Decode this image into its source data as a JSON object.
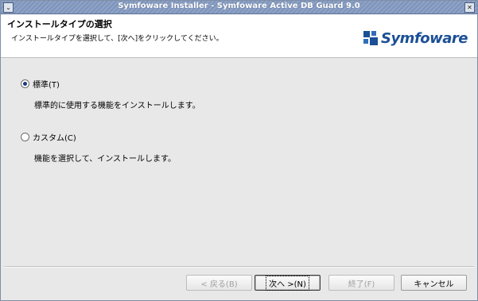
{
  "window": {
    "title": "Symfoware Installer - Symfoware Active DB Guard 9.0",
    "menu_glyph": "⌄",
    "close_glyph": "✕"
  },
  "header": {
    "title": "インストールタイプの選択",
    "subtitle": "インストールタイプを選択して、[次へ]をクリックしてください。",
    "logo_text": "Symfoware",
    "logo_color": "#1b4f96"
  },
  "options": [
    {
      "label": "標準(T)",
      "description": "標準的に使用する機能をインストールします。",
      "selected": true
    },
    {
      "label": "カスタム(C)",
      "description": "機能を選択して、インストールします。",
      "selected": false
    }
  ],
  "buttons": {
    "back_label": "< 戻る(B)",
    "next_label": "次へ >(N)",
    "finish_label": "終了(F)",
    "cancel_label": "キャンセル"
  }
}
